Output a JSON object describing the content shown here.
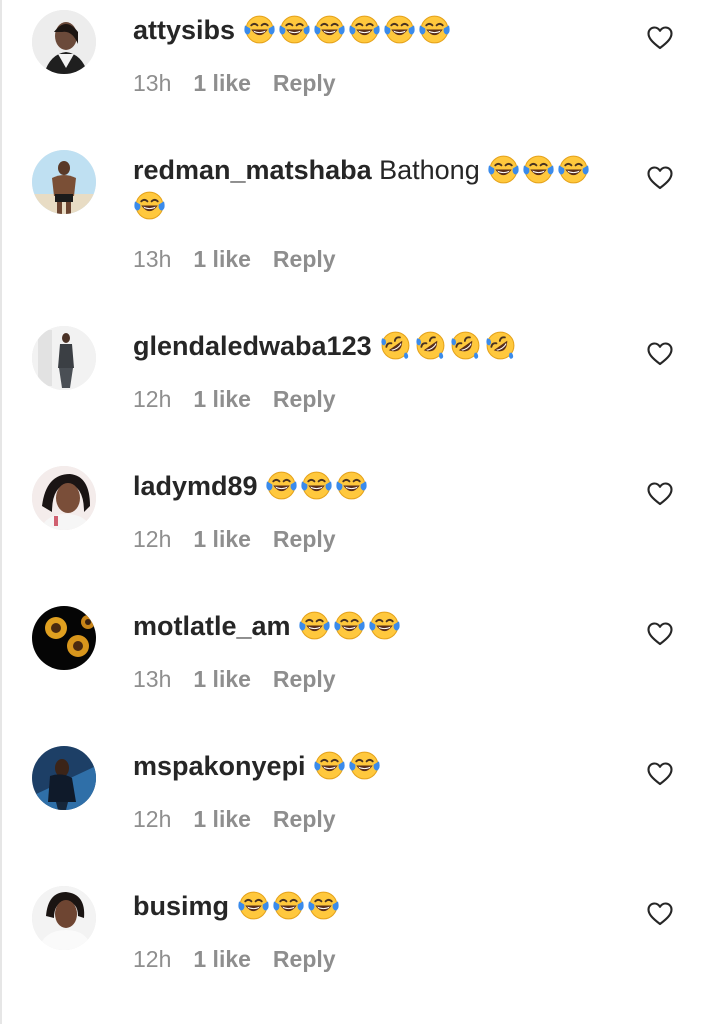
{
  "comments": [
    {
      "username": "attysibs",
      "text": "",
      "emojis": [
        "joy",
        "joy",
        "joy",
        "joy",
        "joy",
        "joy"
      ],
      "time": "13h",
      "likes": "1 like",
      "reply": "Reply",
      "avatar_icon": "avatar-photo-woman"
    },
    {
      "username": "redman_matshaba",
      "text": "Bathong",
      "emojis": [
        "joy",
        "joy",
        "joy",
        "joy"
      ],
      "time": "13h",
      "likes": "1 like",
      "reply": "Reply",
      "avatar_icon": "avatar-photo-man-beach"
    },
    {
      "username": "glendaledwaba123",
      "text": "",
      "emojis": [
        "rofl",
        "rofl",
        "rofl",
        "rofl"
      ],
      "time": "12h",
      "likes": "1 like",
      "reply": "Reply",
      "avatar_icon": "avatar-photo-woman-standing"
    },
    {
      "username": "ladymd89",
      "text": "",
      "emojis": [
        "joy",
        "joy",
        "joy"
      ],
      "time": "12h",
      "likes": "1 like",
      "reply": "Reply",
      "avatar_icon": "avatar-photo-woman-selfie"
    },
    {
      "username": "motlatle_am",
      "text": "",
      "emojis": [
        "joy",
        "joy",
        "joy"
      ],
      "time": "13h",
      "likes": "1 like",
      "reply": "Reply",
      "avatar_icon": "avatar-sunflowers"
    },
    {
      "username": "mspakonyepi",
      "text": "",
      "emojis": [
        "joy",
        "joy"
      ],
      "time": "12h",
      "likes": "1 like",
      "reply": "Reply",
      "avatar_icon": "avatar-photo-woman-blue"
    },
    {
      "username": "busimg",
      "text": "",
      "emojis": [
        "joy",
        "joy",
        "joy"
      ],
      "time": "12h",
      "likes": "1 like",
      "reply": "Reply",
      "avatar_icon": "avatar-photo-woman-white"
    }
  ],
  "colors": {
    "primary_text": "#262626",
    "secondary_text": "#8e8e8e",
    "emoji_face": "#FFC83D",
    "emoji_tears": "#3B8BEB"
  },
  "icons": {
    "like": "heart-outline-icon"
  }
}
